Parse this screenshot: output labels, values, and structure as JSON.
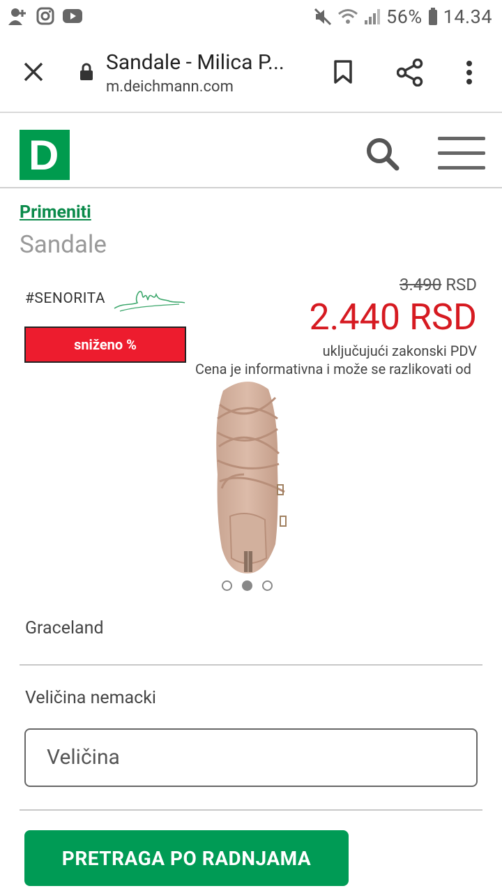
{
  "status_bar": {
    "battery": "56%",
    "time": "14.34"
  },
  "browser": {
    "title": "Sandale - Milica P...",
    "url": "m.deichmann.com"
  },
  "site": {
    "logo_letter": "D",
    "brand_color": "#009b4e"
  },
  "product": {
    "breadcrumb": "Primeniti",
    "category": "Sandale",
    "collection_tag": "#SENORITA",
    "sale_badge": "sniženo %",
    "old_price_value": "3.490",
    "old_price_currency": "RSD",
    "new_price": "2.440 RSD",
    "vat_note": "uključujući zakonski PDV",
    "price_note": "Cena je informativna i može se razlikovati od",
    "brand": "Graceland",
    "size_label": "Veličina nemacki",
    "size_placeholder": "Veličina",
    "store_search_button": "PRETRAGA PO RADNJAMA"
  },
  "colors": {
    "sale_red": "#d61a21",
    "badge_red": "#ed1c2e",
    "button_green": "#009b55"
  }
}
